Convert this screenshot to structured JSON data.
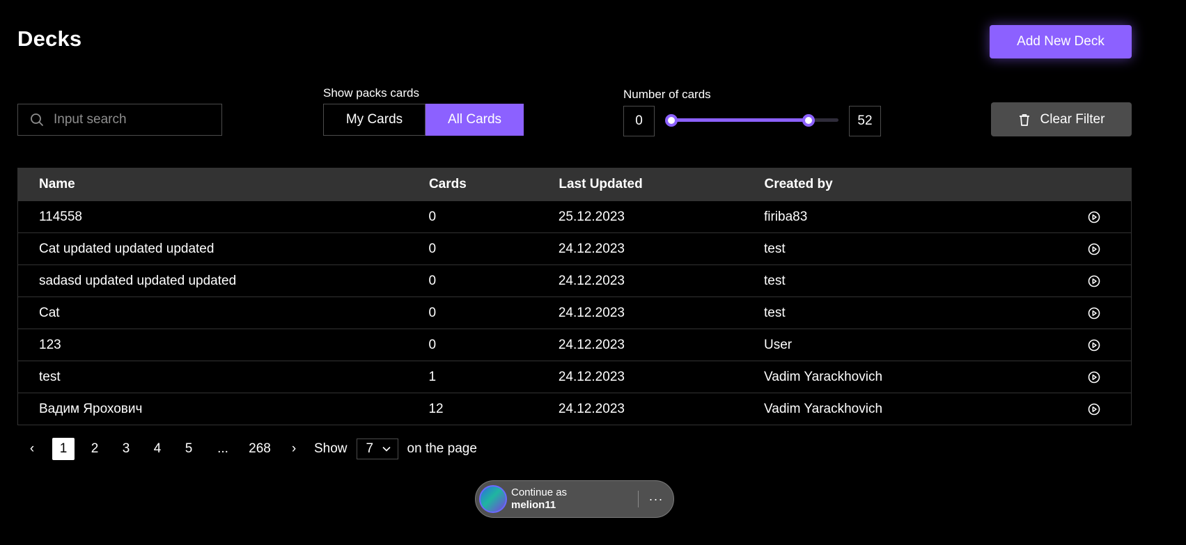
{
  "page": {
    "title": "Decks"
  },
  "header": {
    "add_button": "Add New Deck"
  },
  "filters": {
    "search_placeholder": "Input search",
    "search_value": "",
    "show_packs_label": "Show packs cards",
    "toggle": {
      "my_cards": "My Cards",
      "all_cards": "All Cards",
      "selected": "All Cards"
    },
    "number_of_cards_label": "Number of cards",
    "range_min": "0",
    "range_max": "52",
    "clear_button": "Clear Filter"
  },
  "table": {
    "headers": {
      "name": "Name",
      "cards": "Cards",
      "last_updated": "Last Updated",
      "created_by": "Created by"
    },
    "rows": [
      {
        "name": "114558",
        "cards": "0",
        "last_updated": "25.12.2023",
        "created_by": "firiba83"
      },
      {
        "name": "Cat updated updated updated",
        "cards": "0",
        "last_updated": "24.12.2023",
        "created_by": "test"
      },
      {
        "name": "sadasd updated updated updated",
        "cards": "0",
        "last_updated": "24.12.2023",
        "created_by": "test"
      },
      {
        "name": "Cat",
        "cards": "0",
        "last_updated": "24.12.2023",
        "created_by": "test"
      },
      {
        "name": "123",
        "cards": "0",
        "last_updated": "24.12.2023",
        "created_by": "User"
      },
      {
        "name": "test",
        "cards": "1",
        "last_updated": "24.12.2023",
        "created_by": "Vadim Yarackhovich"
      },
      {
        "name": "Вадим Ярохович",
        "cards": "12",
        "last_updated": "24.12.2023",
        "created_by": "Vadim Yarackhovich"
      }
    ],
    "row_action_icon": "play-circle-icon"
  },
  "pagination": {
    "prev": "‹",
    "pages": [
      "1",
      "2",
      "3",
      "4",
      "5",
      "...",
      "268"
    ],
    "current": "1",
    "next": "›",
    "show_label": "Show",
    "per_page": "7",
    "suffix": "on the page"
  },
  "account_prompt": {
    "line1": "Continue as",
    "username": "melion11",
    "more": "···"
  },
  "colors": {
    "accent": "#8c61ff",
    "surface": "#333333",
    "border": "#4c4c4c"
  }
}
